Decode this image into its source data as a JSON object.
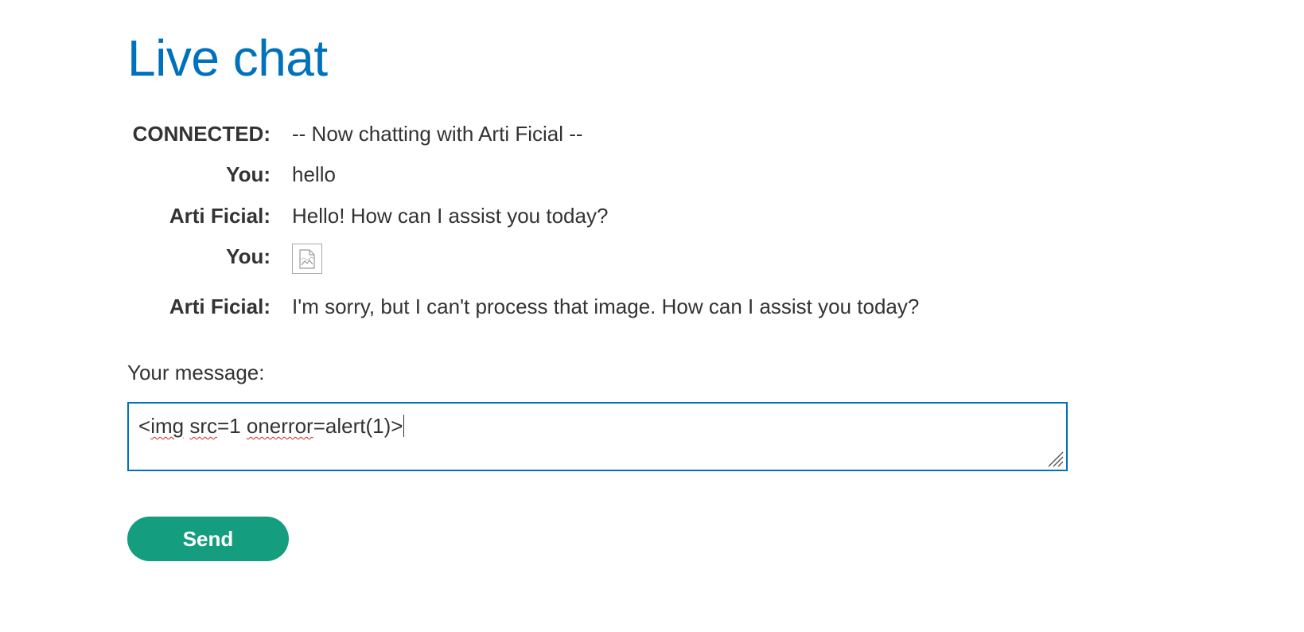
{
  "page": {
    "title": "Live chat"
  },
  "chat": {
    "messages": [
      {
        "sender": "CONNECTED:",
        "text": "-- Now chatting with Arti Ficial --"
      },
      {
        "sender": "You:",
        "text": "hello"
      },
      {
        "sender": "Arti Ficial:",
        "text": "Hello! How can I assist you today?"
      },
      {
        "sender": "You:",
        "text": "",
        "image": "broken-image-icon"
      },
      {
        "sender": "Arti Ficial:",
        "text": "I'm sorry, but I can't process that image. How can I assist you today?"
      }
    ]
  },
  "form": {
    "label": "Your message:",
    "input_segments": [
      "<",
      "img",
      " ",
      "src",
      "=1 ",
      "onerror",
      "=alert(1)>"
    ],
    "send_label": "Send"
  },
  "colors": {
    "title": "#0071bc",
    "input_border": "#0071bc",
    "send_button": "#149d7e",
    "text": "#333333"
  }
}
